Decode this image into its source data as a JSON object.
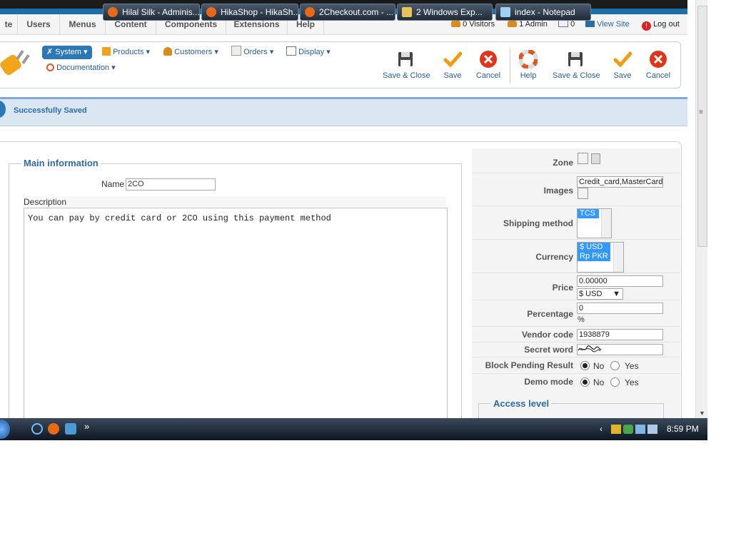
{
  "menu": [
    "te",
    "Users",
    "Menus",
    "Content",
    "Components",
    "Extensions",
    "Help"
  ],
  "status": {
    "visitors": "0 Visitors",
    "admin": "1 Admin",
    "messages": "0",
    "view_site": "View Site",
    "logout": "Log out"
  },
  "nav": {
    "system": "System",
    "products": "Products",
    "customers": "Customers",
    "orders": "Orders",
    "display": "Display",
    "documentation": "Documentation"
  },
  "toolbar": {
    "save_close_1": "Save & Close",
    "save_1": "Save",
    "cancel_1": "Cancel",
    "help": "Help",
    "save_close_2": "Save & Close",
    "save_2": "Save",
    "cancel_2": "Cancel"
  },
  "message": "Successfully Saved",
  "main": {
    "legend": "Main information",
    "name_label": "Name",
    "name_value": "2CO",
    "description_label": "Description",
    "description_text": "You can pay by credit card or 2CO using this payment method"
  },
  "side": {
    "zone_label": "Zone",
    "images_label": "Images",
    "images_value": "Credit_card,MasterCard,\\",
    "shipping_label": "Shipping method",
    "shipping_options": [
      "TCS"
    ],
    "currency_label": "Currency",
    "currency_options": [
      "$ USD",
      "Rp PKR"
    ],
    "price_label": "Price",
    "price_value": "0.00000",
    "price_currency": "$ USD",
    "percentage_label": "Percentage",
    "percentage_value": "0",
    "percentage_unit": "%",
    "vendor_label": "Vendor code",
    "vendor_value": "1938879",
    "secret_label": "Secret word",
    "secret_value": "",
    "block_label": "Block Pending Result",
    "demo_label": "Demo mode",
    "no_label": "No",
    "yes_label": "Yes",
    "access_legend": "Access level"
  },
  "taskbar": {
    "tasks": [
      "Hilal Silk - Adminis...",
      "HikaShop - HikaSh...",
      "2Checkout.com - ...",
      "2 Windows Exp...",
      "index - Notepad"
    ],
    "clock": "8:59 PM"
  }
}
